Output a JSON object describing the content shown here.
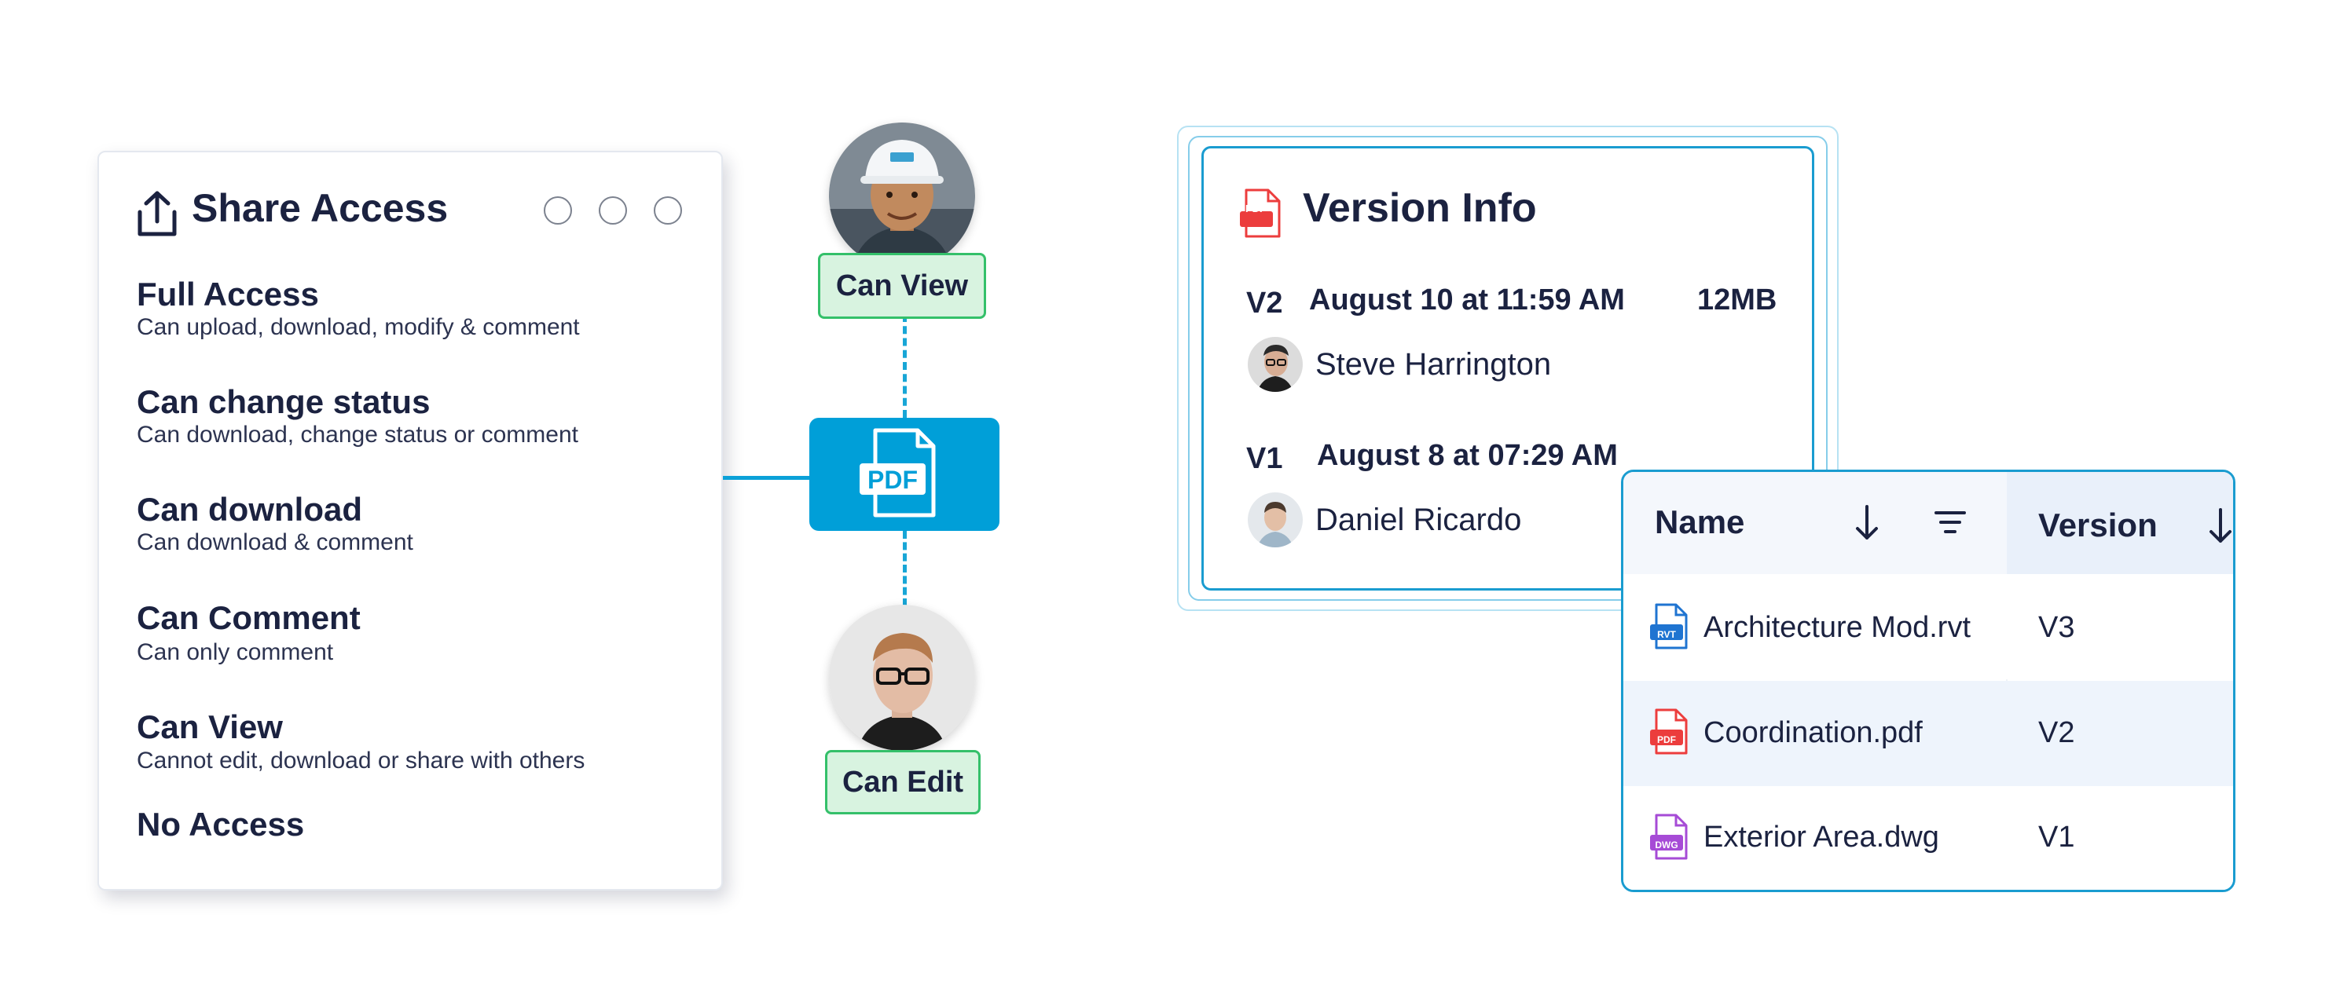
{
  "share": {
    "title": "Share Access",
    "permissions": [
      {
        "title": "Full Access",
        "description": "Can upload, download, modify & comment"
      },
      {
        "title": "Can change status",
        "description": "Can download, change status or comment"
      },
      {
        "title": "Can download",
        "description": "Can download & comment"
      },
      {
        "title": "Can Comment",
        "description": "Can only comment"
      },
      {
        "title": "Can View",
        "description": "Cannot edit, download or share with others"
      },
      {
        "title": "No Access",
        "description": ""
      }
    ]
  },
  "graph": {
    "top_role": "Can View",
    "node_label": "PDF",
    "bottom_role": "Can Edit"
  },
  "version_info": {
    "title": "Version Info",
    "icon_label": "PDF",
    "entries": [
      {
        "version": "V2",
        "date": "August 10 at 11:59 AM",
        "size": "12MB",
        "user": "Steve Harrington"
      },
      {
        "version": "V1",
        "date": "August 8 at 07:29 AM",
        "size": "",
        "user": "Daniel Ricardo"
      }
    ]
  },
  "files_table": {
    "columns": {
      "name": "Name",
      "version": "Version"
    },
    "rows": [
      {
        "name": "Architecture Mod.rvt",
        "version": "V3",
        "icon_label": "RVT",
        "icon_color": "#1f74d1"
      },
      {
        "name": "Coordination.pdf",
        "version": "V2",
        "icon_label": "PDF",
        "icon_color": "#ec3d3d"
      },
      {
        "name": "Exterior Area.dwg",
        "version": "V1",
        "icon_label": "DWG",
        "icon_color": "#a64bd6"
      }
    ]
  },
  "colors": {
    "accent": "#009fd8",
    "role_badge_bg": "#d8f3e0",
    "role_badge_border": "#34c06a",
    "text": "#1b2240"
  }
}
